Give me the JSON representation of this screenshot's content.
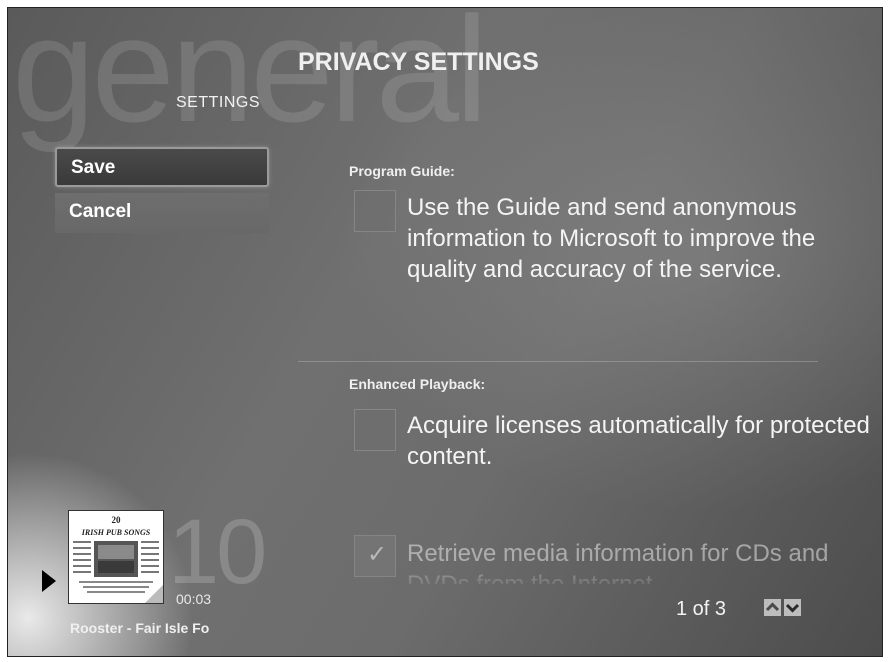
{
  "header": {
    "watermark": "general",
    "breadcrumb": "SETTINGS",
    "title": "PRIVACY SETTINGS"
  },
  "sidebar": {
    "save_label": "Save",
    "cancel_label": "Cancel"
  },
  "sections": [
    {
      "label": "Program Guide:",
      "option_text": "Use the Guide and send anonymous information to Microsoft to improve the quality and accuracy of the service.",
      "checked": false
    },
    {
      "label": "Enhanced Playback:",
      "option_text": "Acquire licenses automatically for protected content.",
      "checked": false
    },
    {
      "label": "",
      "option_text": "Retrieve media information for CDs and DVDs from the Internet",
      "checked": true
    }
  ],
  "pagination": {
    "indicator": "1 of 3",
    "up_icon": "arrow-up-icon",
    "down_icon": "arrow-down-icon"
  },
  "now_playing": {
    "big_number": "10",
    "elapsed": "00:03",
    "track": "Rooster - Fair Isle Fo",
    "album_art_text": {
      "number": "20",
      "title": "IRISH PUB SONGS"
    },
    "play_icon": "play-icon"
  }
}
